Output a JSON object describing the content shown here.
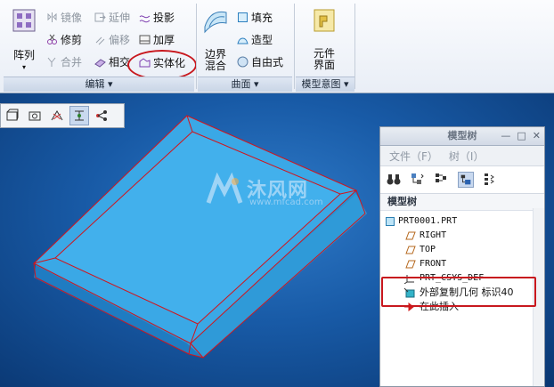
{
  "ribbon": {
    "edit_group": {
      "label": "编辑",
      "pattern_label": "阵列",
      "mirror_label": "镜像",
      "trim_label": "修剪",
      "merge_label": "合并",
      "extend_label": "延伸",
      "offset_label": "偏移",
      "intersect_label": "相交",
      "project_label": "投影",
      "thicken_label": "加厚",
      "solidify_label": "实体化"
    },
    "surface_group": {
      "label": "曲面",
      "boundary_blend_label": "边界\n混合",
      "fill_label": "填充",
      "style_label": "造型",
      "freeform_label": "自由式"
    },
    "model_intent_group": {
      "label": "模型意图",
      "component_interface_label": "元件\n界面"
    }
  },
  "model_tree": {
    "panel_title": "模型树",
    "menu_file": "文件（F）",
    "menu_tree": "树（I）",
    "header": "模型树",
    "nodes": [
      {
        "label": "PRT0001.PRT",
        "icon": "part-icon"
      },
      {
        "label": "RIGHT",
        "icon": "datum-plane-icon"
      },
      {
        "label": "TOP",
        "icon": "datum-plane-icon"
      },
      {
        "label": "FRONT",
        "icon": "datum-plane-icon"
      },
      {
        "label": "PRT_CSYS_DEF",
        "icon": "csys-icon"
      },
      {
        "label": "外部复制几何 标识40",
        "icon": "external-copy-geometry-icon"
      },
      {
        "label": "在此插入",
        "icon": "insert-here-arrow-icon"
      }
    ]
  },
  "watermark": {
    "site_name": "沐风网",
    "url": "www.mfcad.com"
  },
  "colors": {
    "highlight_red": "#c8181e",
    "model_blue": "#3aa8e6",
    "background_blue": "#185aa6"
  }
}
